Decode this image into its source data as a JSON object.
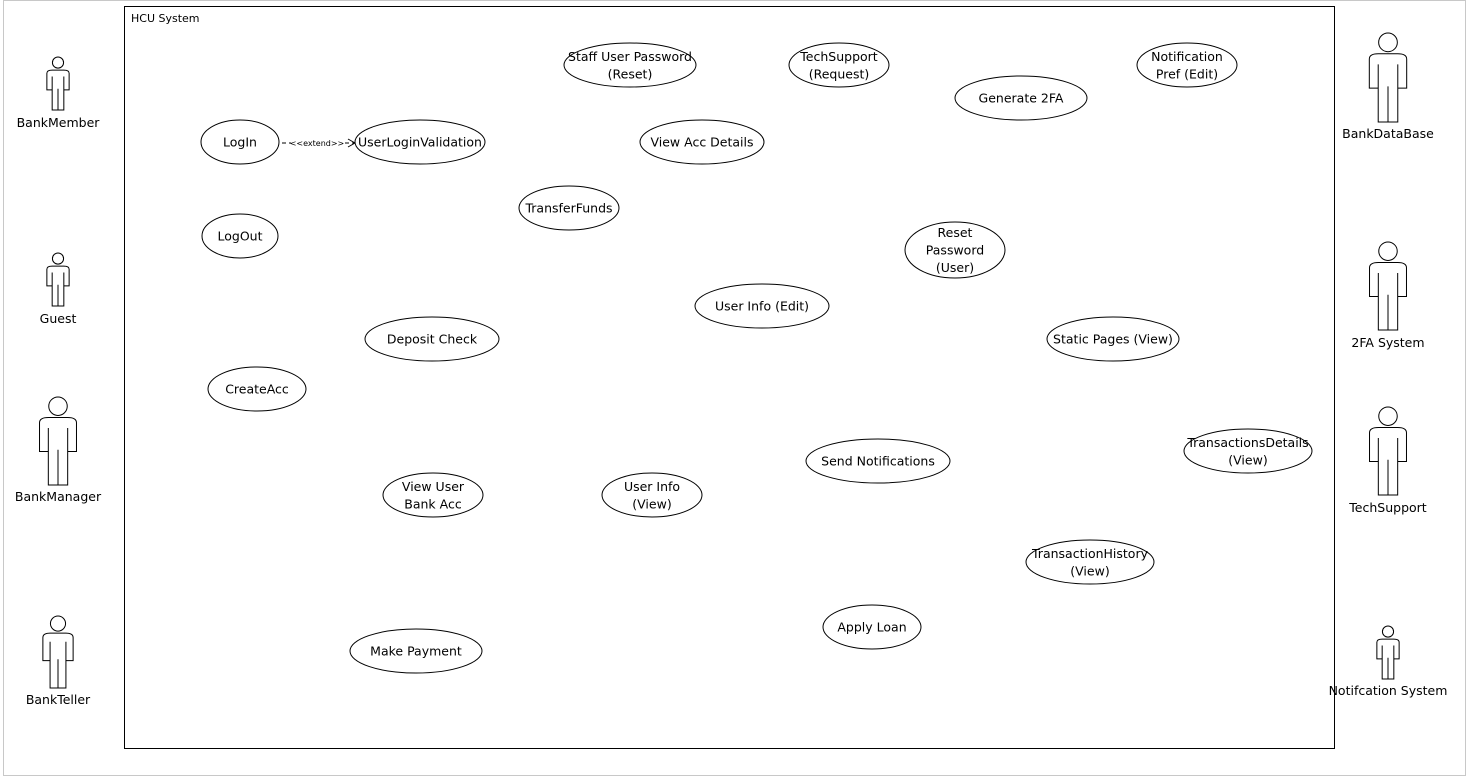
{
  "diagram": {
    "system_title": "HCU System",
    "extend_label": "<<extend>>",
    "colors": {
      "line": "#000000",
      "outer_border": "#c8c8c8",
      "background": "#ffffff"
    },
    "use_cases": [
      {
        "id": "staff-password-reset",
        "lines": [
          "Staff User Password",
          "(Reset)"
        ]
      },
      {
        "id": "techsupport-request",
        "lines": [
          "TechSupport",
          "(Request)"
        ]
      },
      {
        "id": "notification-pref-edit",
        "lines": [
          "Notification",
          "Pref (Edit)"
        ]
      },
      {
        "id": "generate-2fa",
        "lines": [
          "Generate 2FA"
        ]
      },
      {
        "id": "login",
        "lines": [
          "LogIn"
        ]
      },
      {
        "id": "user-login-validation",
        "lines": [
          "UserLoginValidation"
        ]
      },
      {
        "id": "view-acc-details",
        "lines": [
          "View Acc Details"
        ]
      },
      {
        "id": "transfer-funds",
        "lines": [
          "TransferFunds"
        ]
      },
      {
        "id": "logout",
        "lines": [
          "LogOut"
        ]
      },
      {
        "id": "reset-password-user",
        "lines": [
          "Reset",
          "Password",
          "(User)"
        ]
      },
      {
        "id": "user-info-edit",
        "lines": [
          "User Info (Edit)"
        ]
      },
      {
        "id": "deposit-check",
        "lines": [
          "Deposit Check"
        ]
      },
      {
        "id": "static-pages-view",
        "lines": [
          "Static Pages (View)"
        ]
      },
      {
        "id": "create-acc",
        "lines": [
          "CreateAcc"
        ]
      },
      {
        "id": "transactions-details-view",
        "lines": [
          "TransactionsDetails",
          "(View)"
        ]
      },
      {
        "id": "send-notifications",
        "lines": [
          "Send Notifications"
        ]
      },
      {
        "id": "view-user-bank-acc",
        "lines": [
          "View User",
          "Bank Acc"
        ]
      },
      {
        "id": "user-info-view",
        "lines": [
          "User Info",
          "(View)"
        ]
      },
      {
        "id": "transaction-history-view",
        "lines": [
          "TransactionHistory",
          "(View)"
        ]
      },
      {
        "id": "apply-loan",
        "lines": [
          "Apply Loan"
        ]
      },
      {
        "id": "make-payment",
        "lines": [
          "Make Payment"
        ]
      }
    ],
    "actors": [
      {
        "id": "bank-member",
        "label": "BankMember"
      },
      {
        "id": "guest",
        "label": "Guest"
      },
      {
        "id": "bank-manager",
        "label": "BankManager"
      },
      {
        "id": "bank-teller",
        "label": "BankTeller"
      },
      {
        "id": "bank-database",
        "label": "BankDataBase"
      },
      {
        "id": "2fa-system",
        "label": "2FA System"
      },
      {
        "id": "tech-support",
        "label": "TechSupport"
      },
      {
        "id": "notification-system",
        "label": "Notifcation System"
      }
    ]
  }
}
